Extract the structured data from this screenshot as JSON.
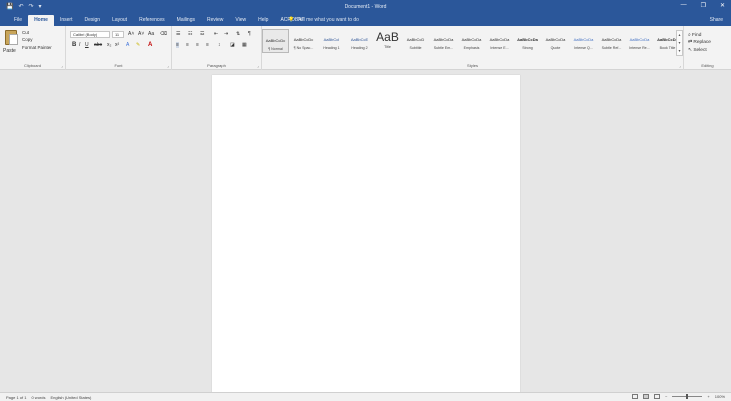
{
  "window": {
    "title": "Document1 - Word",
    "controls": [
      "—",
      "❐",
      "✕"
    ]
  },
  "qat": {
    "save": "💾",
    "undo": "↶",
    "redo": "↷",
    "more": "▾"
  },
  "tabs": [
    "File",
    "Home",
    "Insert",
    "Design",
    "Layout",
    "References",
    "Mailings",
    "Review",
    "View",
    "Help",
    "ACROBAT"
  ],
  "active_tab": "Home",
  "tellme": "Tell me what you want to do",
  "share": "Share",
  "ribbon": {
    "clipboard": {
      "label": "Clipboard",
      "paste": "Paste",
      "cut": "Cut",
      "copy": "Copy",
      "format_painter": "Format Painter"
    },
    "font": {
      "label": "Font",
      "family": "Calibri (Body)",
      "size": "11"
    },
    "paragraph": {
      "label": "Paragraph"
    },
    "styles": {
      "label": "Styles",
      "items": [
        {
          "sample": "AaBbCcDc",
          "name": "¶ Normal"
        },
        {
          "sample": "AaBbCcDc",
          "name": "¶ No Spac..."
        },
        {
          "sample": "AaBbCcI",
          "name": "Heading 1"
        },
        {
          "sample": "AaBbCcE",
          "name": "Heading 2"
        },
        {
          "sample": "AaB",
          "name": "Title"
        },
        {
          "sample": "AaBbCcD",
          "name": "Subtitle"
        },
        {
          "sample": "AaBbCcDa",
          "name": "Subtle Em..."
        },
        {
          "sample": "AaBbCcDa",
          "name": "Emphasis"
        },
        {
          "sample": "AaBbCcDa",
          "name": "Intense E..."
        },
        {
          "sample": "AaBbCcDa",
          "name": "Strong"
        },
        {
          "sample": "AaBbCcDa",
          "name": "Quote"
        },
        {
          "sample": "AaBbCcDa",
          "name": "Intense Q..."
        },
        {
          "sample": "AaBbCcDa",
          "name": "Subtle Ref..."
        },
        {
          "sample": "AaBbCcDa",
          "name": "Intense Re..."
        },
        {
          "sample": "AaBbCcDa",
          "name": "Book Title"
        }
      ]
    },
    "editing": {
      "label": "Editing",
      "find": "Find",
      "replace": "Replace",
      "select": "Select"
    }
  },
  "statusbar": {
    "page": "Page 1 of 1",
    "words": "0 words",
    "language": "English (United States)",
    "zoom": "100%"
  },
  "colors": {
    "brand": "#2b579a",
    "ribbon_bg": "#f3f3f3",
    "canvas": "#e6e6e6",
    "page": "#ffffff"
  }
}
